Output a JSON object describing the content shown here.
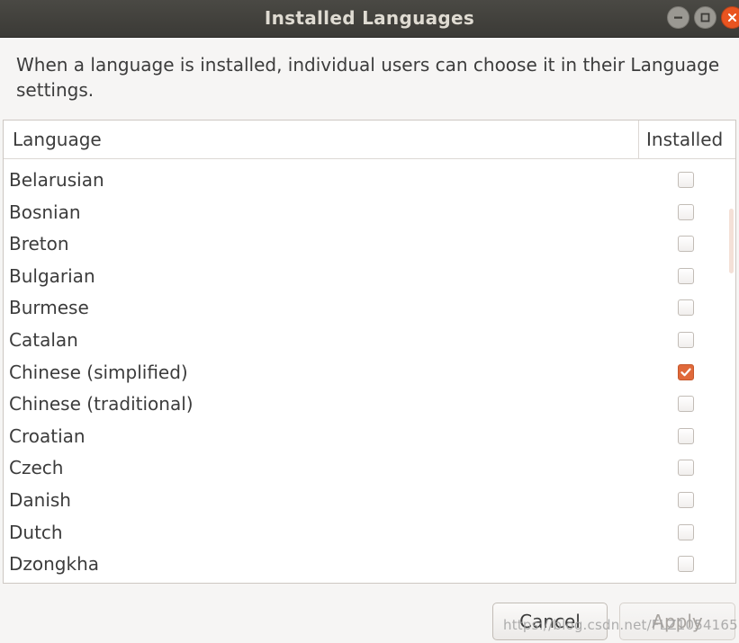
{
  "window": {
    "title": "Installed Languages",
    "controls": [
      {
        "name": "minimize",
        "icon": "minimize-icon"
      },
      {
        "name": "maximize",
        "icon": "maximize-icon"
      },
      {
        "name": "close",
        "icon": "close-icon"
      }
    ]
  },
  "description": "When a language is installed, individual users can choose it in their Language settings.",
  "table": {
    "columns": {
      "language": "Language",
      "installed": "Installed"
    },
    "rows": [
      {
        "language": "Belarusian",
        "installed": false
      },
      {
        "language": "Bosnian",
        "installed": false
      },
      {
        "language": "Breton",
        "installed": false
      },
      {
        "language": "Bulgarian",
        "installed": false
      },
      {
        "language": "Burmese",
        "installed": false
      },
      {
        "language": "Catalan",
        "installed": false
      },
      {
        "language": "Chinese (simplified)",
        "installed": true
      },
      {
        "language": "Chinese (traditional)",
        "installed": false
      },
      {
        "language": "Croatian",
        "installed": false
      },
      {
        "language": "Czech",
        "installed": false
      },
      {
        "language": "Danish",
        "installed": false
      },
      {
        "language": "Dutch",
        "installed": false
      },
      {
        "language": "Dzongkha",
        "installed": false
      }
    ]
  },
  "buttons": {
    "cancel": "Cancel",
    "apply": "Apply"
  },
  "watermark": "https://blog.csdn.net/FLZ1054165129",
  "colors": {
    "accent": "#e0693a",
    "titlebar": "#3c3b37",
    "close": "#e95420"
  }
}
